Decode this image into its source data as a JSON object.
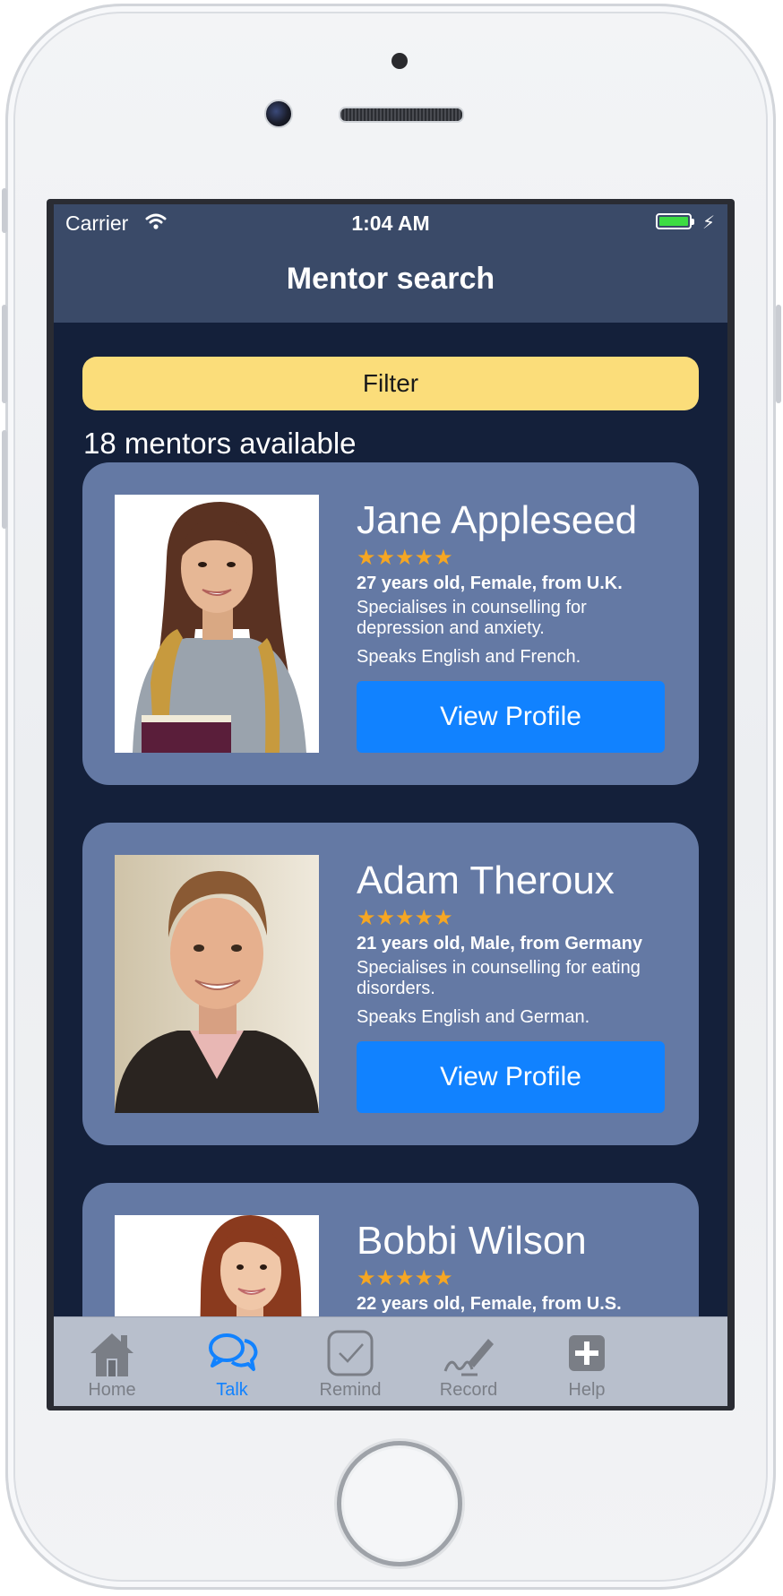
{
  "status_bar": {
    "carrier": "Carrier",
    "time": "1:04 AM"
  },
  "nav": {
    "title": "Mentor search"
  },
  "filter": {
    "label": "Filter"
  },
  "mentor_count": "18 mentors available",
  "mentors": [
    {
      "name": "Jane Appleseed",
      "rating": "★★★★★",
      "details": "27 years old, Female, from U.K.",
      "specialty": "Specialises in counselling for depression and anxiety.",
      "languages": "Speaks English and French.",
      "button": "View Profile"
    },
    {
      "name": "Adam Theroux",
      "rating": "★★★★★",
      "details": "21 years old, Male, from Germany",
      "specialty": "Specialises in counselling for eating disorders.",
      "languages": "Speaks English and German.",
      "button": "View Profile"
    },
    {
      "name": "Bobbi Wilson",
      "rating": "★★★★★",
      "details": "22 years old, Female, from U.S."
    }
  ],
  "tabs": [
    {
      "label": "Home",
      "icon": "house-icon"
    },
    {
      "label": "Talk",
      "icon": "chat-bubbles-icon"
    },
    {
      "label": "Remind",
      "icon": "checkbox-icon"
    },
    {
      "label": "Record",
      "icon": "pen-signature-icon"
    },
    {
      "label": "Help",
      "icon": "plus-square-icon"
    }
  ],
  "colors": {
    "nav_bar": "#3a4a68",
    "background": "#14203a",
    "card": "#6479a4",
    "filter": "#fbdd7a",
    "primary_button": "#1182ff",
    "stars": "#f5a623",
    "tab_bar": "#b8bfcc",
    "tab_active": "#1182ff",
    "tab_inactive": "#7a7e86"
  }
}
